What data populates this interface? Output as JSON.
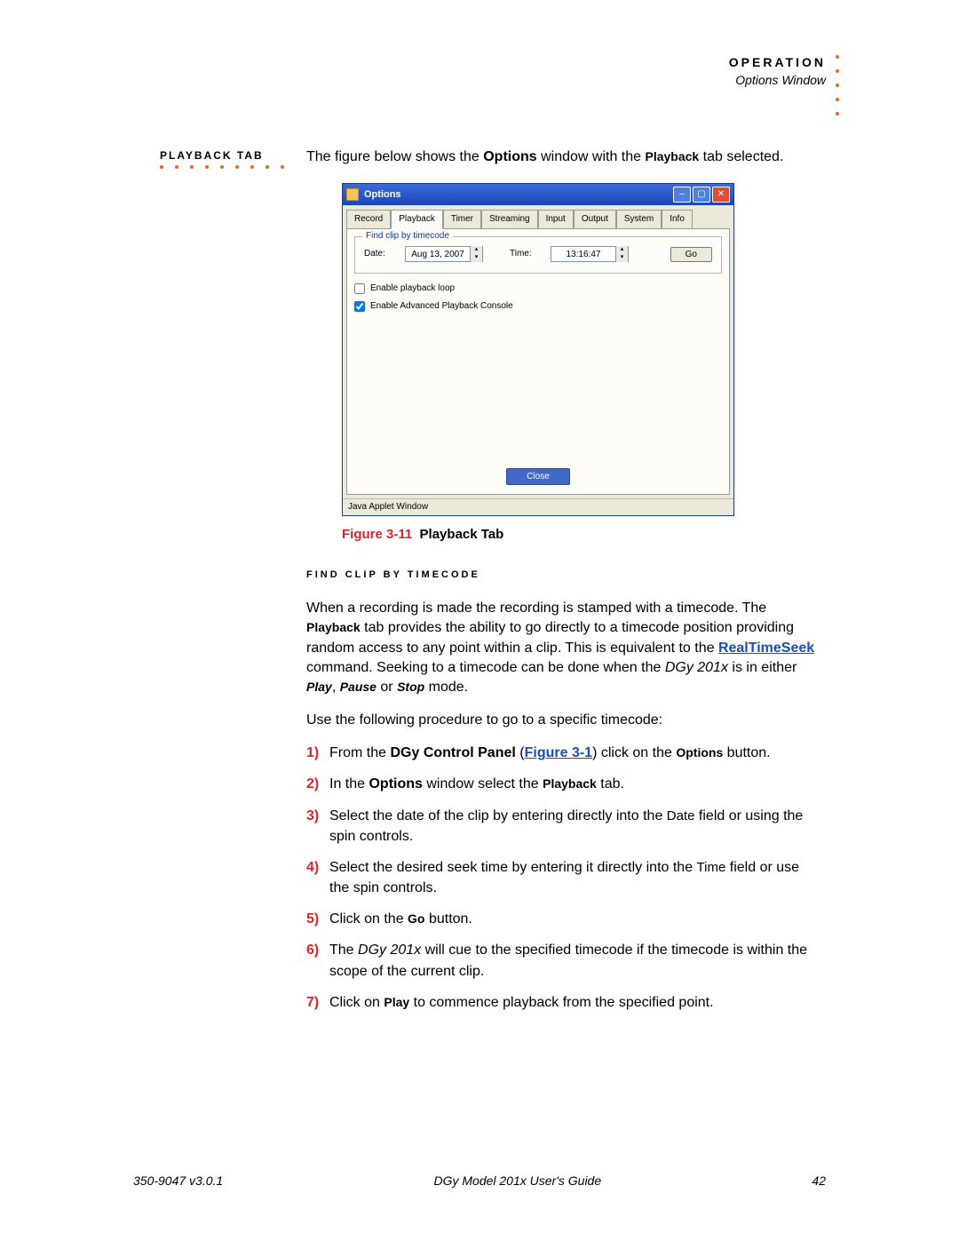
{
  "header": {
    "chapter": "OPERATION",
    "section": "Options Window"
  },
  "sidebar": {
    "label": "PLAYBACK TAB"
  },
  "intro": {
    "pre": "The figure below shows the ",
    "bold1": "Options",
    "mid": " window with the ",
    "bold2": "Playback",
    "post": " tab selected."
  },
  "optionsWindow": {
    "title": "Options",
    "tabs": [
      "Record",
      "Playback",
      "Timer",
      "Streaming",
      "Input",
      "Output",
      "System",
      "Info"
    ],
    "activeTab": "Playback",
    "group": {
      "legend": "Find clip by timecode",
      "dateLabel": "Date:",
      "dateValue": "Aug 13, 2007",
      "timeLabel": "Time:",
      "timeValue": "13:16:47",
      "goLabel": "Go"
    },
    "checkbox1": {
      "label": "Enable playback loop",
      "checked": false
    },
    "checkbox2": {
      "label": "Enable Advanced Playback Console",
      "checked": true
    },
    "closeLabel": "Close",
    "status": "Java Applet Window"
  },
  "caption": {
    "prefix": "Figure 3-11",
    "text": "Playback Tab"
  },
  "subsection": "FIND CLIP BY TIMECODE",
  "p1": {
    "a": "When a recording is made the recording is stamped with a timecode. The ",
    "b": "Playback",
    "c": " tab provides the ability to go directly to a timecode position providing random access to any point within a clip. This is equivalent to the ",
    "link": "RealTimeSeek",
    "d": " command. Seeking to a timecode can be done when the ",
    "model": "DGy 201x",
    "e": " is in either ",
    "m1": "Play",
    "comma": ", ",
    "m2": "Pause",
    "or": " or ",
    "m3": "Stop",
    "f": " mode."
  },
  "p2": "Use the following procedure to go to a specific timecode:",
  "steps": [
    {
      "n": "1)",
      "pre": "From the ",
      "b1": "DGy Control Panel",
      "mid": " (",
      "link": "Figure 3-1",
      "post": ") click on the ",
      "b2": "Options",
      "tail": " button."
    },
    {
      "n": "2)",
      "pre": "In the ",
      "b1": "Options",
      "mid": " window select the ",
      "b2": "Playback",
      "tail": " tab."
    },
    {
      "n": "3)",
      "pre": "Select the date of the clip by entering directly into the ",
      "code": "Date",
      "tail": " field or using the spin controls."
    },
    {
      "n": "4)",
      "pre": "Select the desired seek time by entering it directly into the ",
      "code": "Time",
      "tail": " field or use the spin controls."
    },
    {
      "n": "5)",
      "pre": "Click on the ",
      "b1": "Go",
      "tail": " button."
    },
    {
      "n": "6)",
      "pre": "The ",
      "it": "DGy 201x",
      "mid": " will cue to the specified timecode if the timecode is within the scope of the current clip.",
      "tail": ""
    },
    {
      "n": "7)",
      "pre": "Click on ",
      "b1": "Play",
      "tail": " to commence playback from the specified point."
    }
  ],
  "footer": {
    "left": "350-9047 v3.0.1",
    "center": "DGy Model 201x User's Guide",
    "page": "42"
  }
}
